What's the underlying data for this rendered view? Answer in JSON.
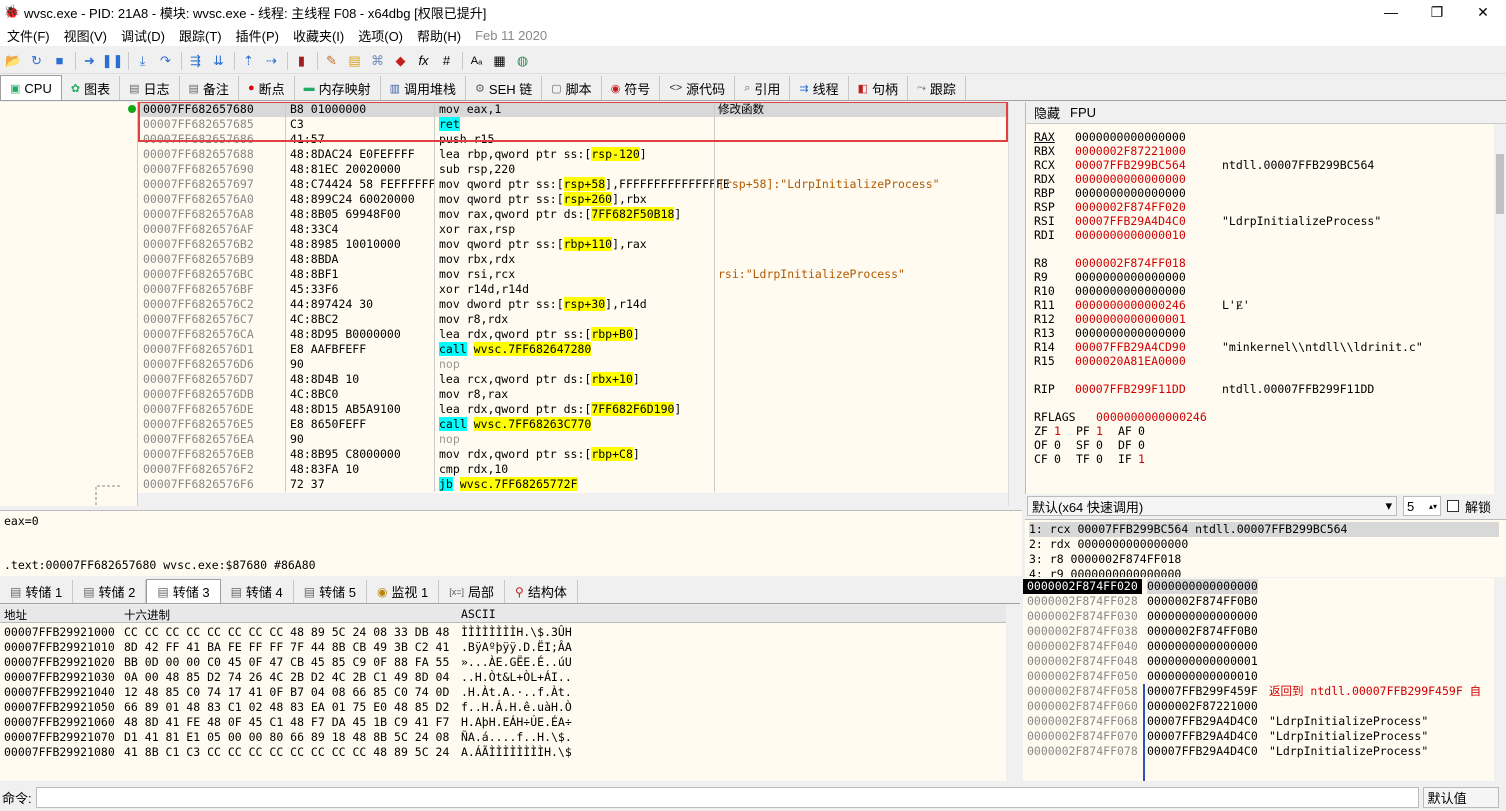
{
  "window": {
    "title": "wvsc.exe - PID: 21A8 - 模块: wvsc.exe - 线程: 主线程 F08 - x64dbg [权限已提升]",
    "icon": "bug-icon",
    "min": "—",
    "max": "❐",
    "close": "✕"
  },
  "menu": [
    "文件(F)",
    "视图(V)",
    "调试(D)",
    "跟踪(T)",
    "插件(P)",
    "收藏夹(I)",
    "选项(O)",
    "帮助(H)",
    "Feb 11 2020"
  ],
  "toolbar": [
    "open-icon",
    "restart-icon",
    "stop-icon",
    "run-icon",
    "pause-icon",
    "step-into-icon",
    "step-over-icon",
    "trace-into-icon",
    "trace-over-icon",
    "execute-till-return-icon",
    "run-to-user-code-icon",
    "scylla-icon",
    "patch-icon",
    "comment-icon",
    "label-icon",
    "bookmark-icon",
    "function-icon",
    "hash-icon",
    "font-icon",
    "calculator-icon",
    "globe-icon"
  ],
  "tabs": [
    {
      "label": "CPU",
      "icon": "cpu-icon",
      "active": true
    },
    {
      "label": "图表",
      "icon": "graph-icon"
    },
    {
      "label": "日志",
      "icon": "log-icon"
    },
    {
      "label": "备注",
      "icon": "notes-icon"
    },
    {
      "label": "断点",
      "icon": "breakpoint-icon"
    },
    {
      "label": "内存映射",
      "icon": "memory-map-icon"
    },
    {
      "label": "调用堆栈",
      "icon": "call-stack-icon"
    },
    {
      "label": "SEH 链",
      "icon": "seh-icon"
    },
    {
      "label": "脚本",
      "icon": "script-icon"
    },
    {
      "label": "符号",
      "icon": "symbol-icon"
    },
    {
      "label": "源代码",
      "icon": "source-icon"
    },
    {
      "label": "引用",
      "icon": "references-icon"
    },
    {
      "label": "线程",
      "icon": "threads-icon"
    },
    {
      "label": "句柄",
      "icon": "handles-icon"
    },
    {
      "label": "跟踪",
      "icon": "trace-icon"
    }
  ],
  "disasm": [
    {
      "addr": "00007FF682657680",
      "bytes": "B8 01000000",
      "ins": "mov eax,1",
      "cmt": "修改函数",
      "sel": true
    },
    {
      "addr": "00007FF682657685",
      "bytes": "C3",
      "ins": "ret"
    },
    {
      "addr": "00007FF682657686",
      "bytes": "41:57",
      "ins": "push r15"
    },
    {
      "addr": "00007FF682657688",
      "bytes": "48:8DAC24 E0FEFFFF",
      "ins": "lea rbp,qword ptr ss:[rsp-120]"
    },
    {
      "addr": "00007FF682657690",
      "bytes": "48:81EC 20020000",
      "ins": "sub rsp,220"
    },
    {
      "addr": "00007FF682657697",
      "bytes": "48:C74424 58 FEFFFFFF",
      "ins": "mov qword ptr ss:[rsp+58],FFFFFFFFFFFFFFFE",
      "cmt": "[rsp+58]:\"LdrpInitializeProcess\""
    },
    {
      "addr": "00007FF6826576A0",
      "bytes": "48:899C24 60020000",
      "ins": "mov qword ptr ss:[rsp+260],rbx"
    },
    {
      "addr": "00007FF6826576A8",
      "bytes": "48:8B05 69948F00",
      "ins": "mov rax,qword ptr ds:[7FF682F50B18]"
    },
    {
      "addr": "00007FF6826576AF",
      "bytes": "48:33C4",
      "ins": "xor rax,rsp"
    },
    {
      "addr": "00007FF6826576B2",
      "bytes": "48:8985 10010000",
      "ins": "mov qword ptr ss:[rbp+110],rax"
    },
    {
      "addr": "00007FF6826576B9",
      "bytes": "48:8BDA",
      "ins": "mov rbx,rdx"
    },
    {
      "addr": "00007FF6826576BC",
      "bytes": "48:8BF1",
      "ins": "mov rsi,rcx",
      "cmt": "rsi:\"LdrpInitializeProcess\""
    },
    {
      "addr": "00007FF6826576BF",
      "bytes": "45:33F6",
      "ins": "xor r14d,r14d"
    },
    {
      "addr": "00007FF6826576C2",
      "bytes": "44:897424 30",
      "ins": "mov dword ptr ss:[rsp+30],r14d"
    },
    {
      "addr": "00007FF6826576C7",
      "bytes": "4C:8BC2",
      "ins": "mov r8,rdx"
    },
    {
      "addr": "00007FF6826576CA",
      "bytes": "48:8D95 B0000000",
      "ins": "lea rdx,qword ptr ss:[rbp+B0]"
    },
    {
      "addr": "00007FF6826576D1",
      "bytes": "E8 AAFBFEFF",
      "ins": "call wvsc.7FF682647280"
    },
    {
      "addr": "00007FF6826576D6",
      "bytes": "90",
      "ins": "nop"
    },
    {
      "addr": "00007FF6826576D7",
      "bytes": "48:8D4B 10",
      "ins": "lea rcx,qword ptr ds:[rbx+10]"
    },
    {
      "addr": "00007FF6826576DB",
      "bytes": "4C:8BC0",
      "ins": "mov r8,rax"
    },
    {
      "addr": "00007FF6826576DE",
      "bytes": "48:8D15 AB5A9100",
      "ins": "lea rdx,qword ptr ds:[7FF682F6D190]"
    },
    {
      "addr": "00007FF6826576E5",
      "bytes": "E8 8650FEFF",
      "ins": "call wvsc.7FF68263C770"
    },
    {
      "addr": "00007FF6826576EA",
      "bytes": "90",
      "ins": "nop"
    },
    {
      "addr": "00007FF6826576EB",
      "bytes": "48:8B95 C8000000",
      "ins": "mov rdx,qword ptr ss:[rbp+C8]"
    },
    {
      "addr": "00007FF6826576F2",
      "bytes": "48:83FA 10",
      "ins": "cmp rdx,10"
    },
    {
      "addr": "00007FF6826576F6",
      "bytes": "72 37",
      "ins": "jb wvsc.7FF68265772F"
    }
  ],
  "info": {
    "line1": "eax=0",
    "line2": ".text:00007FF682657680 wvsc.exe:$87680 #86A80"
  },
  "regs_head": [
    "隐藏",
    "FPU"
  ],
  "regs": [
    {
      "n": "RAX",
      "v": "0000000000000000",
      "c": ""
    },
    {
      "n": "RBX",
      "v": "0000002F87221000",
      "c": "",
      "red": true
    },
    {
      "n": "RCX",
      "v": "00007FFB299BC564",
      "c": "ntdll.00007FFB299BC564",
      "red": true
    },
    {
      "n": "RDX",
      "v": "0000000000000000",
      "c": "",
      "red": true
    },
    {
      "n": "RBP",
      "v": "0000000000000000",
      "c": ""
    },
    {
      "n": "RSP",
      "v": "0000002F874FF020",
      "c": "",
      "red": true
    },
    {
      "n": "RSI",
      "v": "00007FFB29A4D4C0",
      "c": "\"LdrpInitializeProcess\"",
      "red": true
    },
    {
      "n": "RDI",
      "v": "0000000000000010",
      "c": "",
      "red": true
    },
    {
      "n": "",
      "v": "",
      "c": ""
    },
    {
      "n": "R8",
      "v": "0000002F874FF018",
      "c": "",
      "red": true
    },
    {
      "n": "R9",
      "v": "0000000000000000",
      "c": ""
    },
    {
      "n": "R10",
      "v": "0000000000000000",
      "c": ""
    },
    {
      "n": "R11",
      "v": "0000000000000246",
      "c": "L'Ɇ'",
      "red": true
    },
    {
      "n": "R12",
      "v": "0000000000000001",
      "c": "",
      "red": true
    },
    {
      "n": "R13",
      "v": "0000000000000000",
      "c": ""
    },
    {
      "n": "R14",
      "v": "00007FFB29A4CD90",
      "c": "\"minkernel\\\\ntdll\\\\ldrinit.c\"",
      "red": true
    },
    {
      "n": "R15",
      "v": "0000020A81EA0000",
      "c": "",
      "red": true
    },
    {
      "n": "",
      "v": "",
      "c": ""
    },
    {
      "n": "RIP",
      "v": "00007FFB299F11DD",
      "c": "ntdll.00007FFB299F11DD",
      "red": true
    },
    {
      "n": "",
      "v": "",
      "c": ""
    },
    {
      "n": "RFLAGS",
      "v": "0000000000000246",
      "c": "",
      "red": true
    }
  ],
  "flags": [
    [
      {
        "n": "ZF",
        "v": "1",
        "red": true
      },
      {
        "n": "PF",
        "v": "1",
        "red": true
      },
      {
        "n": "AF",
        "v": "0"
      }
    ],
    [
      {
        "n": "OF",
        "v": "0"
      },
      {
        "n": "SF",
        "v": "0"
      },
      {
        "n": "DF",
        "v": "0"
      }
    ],
    [
      {
        "n": "CF",
        "v": "0"
      },
      {
        "n": "TF",
        "v": "0"
      },
      {
        "n": "IF",
        "v": "1",
        "red": true
      }
    ]
  ],
  "callconv": {
    "selected": "默认(x64 快速调用)",
    "count": "5",
    "unlock": "解锁"
  },
  "args": [
    "1: rcx 00007FFB299BC564 ntdll.00007FFB299BC564",
    "2: rdx 0000000000000000",
    "3: r8 0000002F874FF018",
    "4: r9 0000000000000000"
  ],
  "dump_tabs": [
    {
      "label": "转储 1",
      "icon": "dump-icon"
    },
    {
      "label": "转储 2",
      "icon": "dump-icon"
    },
    {
      "label": "转储 3",
      "icon": "dump-icon",
      "active": true
    },
    {
      "label": "转储 4",
      "icon": "dump-icon"
    },
    {
      "label": "转储 5",
      "icon": "dump-icon"
    },
    {
      "label": "监视 1",
      "icon": "watch-icon"
    },
    {
      "label": "局部",
      "icon": "locals-icon"
    },
    {
      "label": "结构体",
      "icon": "struct-icon"
    }
  ],
  "dump_head": {
    "addr": "地址",
    "hex": "十六进制",
    "ascii": "ASCII"
  },
  "dump": [
    {
      "a": "00007FFB29921000",
      "h": "CC CC CC CC CC CC CC CC 48 89 5C 24 08 33 DB 48",
      "s": "ÌÌÌÌÌÌÌÌH.\\$.3ÛH"
    },
    {
      "a": "00007FFB29921010",
      "h": "8D 42 FF 41 BA FE FF FF 7F 44 8B CB 49 3B C2 41",
      "s": ".BÿAºþÿÿ.D.ËI;ÂA"
    },
    {
      "a": "00007FFB29921020",
      "h": "BB 0D 00 00 C0 45 0F 47 CB 45 85 C9 0F 88 FA 55",
      "s": "»...ÀE.GËE.É..úU"
    },
    {
      "a": "00007FFB29921030",
      "h": "0A 00 48 85 D2 74 26 4C 2B D2 4C 2B C1 49 8D 04",
      "s": "..H.Òt&L+ÒL+ÁI.."
    },
    {
      "a": "00007FFB29921040",
      "h": "12 48 85 C0 74 17 41 0F B7 04 08 66 85 C0 74 0D",
      "s": ".H.Àt.A.·..f.Àt."
    },
    {
      "a": "00007FFB29921050",
      "h": "66 89 01 48 83 C1 02 48 83 EA 01 75 E0 48 85 D2",
      "s": "f..H.Á.H.ê.uàH.Ò"
    },
    {
      "a": "00007FFB29921060",
      "h": "48 8D 41 FE 48 0F 45 C1 48 F7 DA 45 1B C9 41 F7",
      "s": "H.AþH.EÁH÷ÚE.ÉA÷"
    },
    {
      "a": "00007FFB29921070",
      "h": "D1 41 81 E1 05 00 00 80 66 89 18 48 8B 5C 24 08",
      "s": "ÑA.á....f..H.\\$."
    },
    {
      "a": "00007FFB29921080",
      "h": "41 8B C1 C3 CC CC CC CC CC CC CC CC 48 89 5C 24",
      "s": "A.ÁÃÌÌÌÌÌÌÌÌH.\\$"
    }
  ],
  "stack": [
    {
      "a": "0000002F874FF020",
      "v": "0000000000000000",
      "c": "",
      "sel": true
    },
    {
      "a": "0000002F874FF028",
      "v": "0000002F874FF0B0",
      "c": ""
    },
    {
      "a": "0000002F874FF030",
      "v": "0000000000000000",
      "c": ""
    },
    {
      "a": "0000002F874FF038",
      "v": "0000002F874FF0B0",
      "c": ""
    },
    {
      "a": "0000002F874FF040",
      "v": "0000000000000000",
      "c": ""
    },
    {
      "a": "0000002F874FF048",
      "v": "0000000000000001",
      "c": ""
    },
    {
      "a": "0000002F874FF050",
      "v": "0000000000000010",
      "c": ""
    },
    {
      "a": "0000002F874FF058",
      "v": "00007FFB299F459F",
      "c": "返回到 ntdll.00007FFB299F459F 自",
      "red": true
    },
    {
      "a": "0000002F874FF060",
      "v": "0000002F87221000",
      "c": ""
    },
    {
      "a": "0000002F874FF068",
      "v": "00007FFB29A4D4C0",
      "c": "\"LdrpInitializeProcess\""
    },
    {
      "a": "0000002F874FF070",
      "v": "00007FFB29A4D4C0",
      "c": "\"LdrpInitializeProcess\""
    },
    {
      "a": "0000002F874FF078",
      "v": "00007FFB29A4D4C0",
      "c": "\"LdrpInitializeProcess\""
    }
  ],
  "cmd": {
    "label": "命令:",
    "dropdown": "默认值"
  }
}
